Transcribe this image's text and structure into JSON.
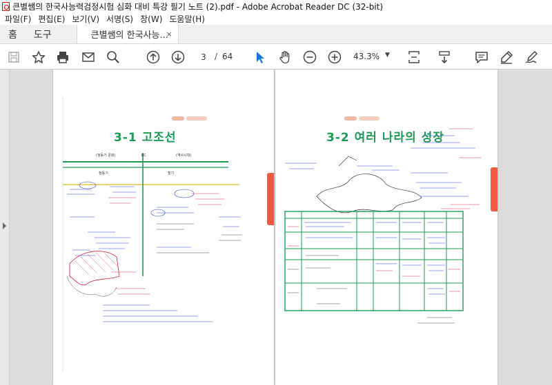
{
  "window": {
    "title": "큰별쌤의 한국사능력검정시험 심화 대비 특강 필기 노트 (2).pdf - Adobe Acrobat Reader DC (32-bit)"
  },
  "menu": [
    "파일(F)",
    "편집(E)",
    "보기(V)",
    "서명(S)",
    "창(W)",
    "도움말(H)"
  ],
  "tabs": {
    "home": "홈",
    "tools": "도구",
    "document": "큰별쌤의 한국사능...",
    "close": "×"
  },
  "toolbar": {
    "current_page": "3",
    "separator": "/",
    "total_pages": "64",
    "zoom": "43.3%",
    "zoom_caret": "▼"
  },
  "pages": {
    "left_heading": "3-1 고조선",
    "right_heading": "3-2 여러 나라의 성장"
  },
  "colors": {
    "accent_green": "#1a9a54",
    "accent_red": "#f05a43",
    "pen_blue": "#2b43c8",
    "pen_red": "#d8344f",
    "toolbar_blue": "#1473e6"
  }
}
